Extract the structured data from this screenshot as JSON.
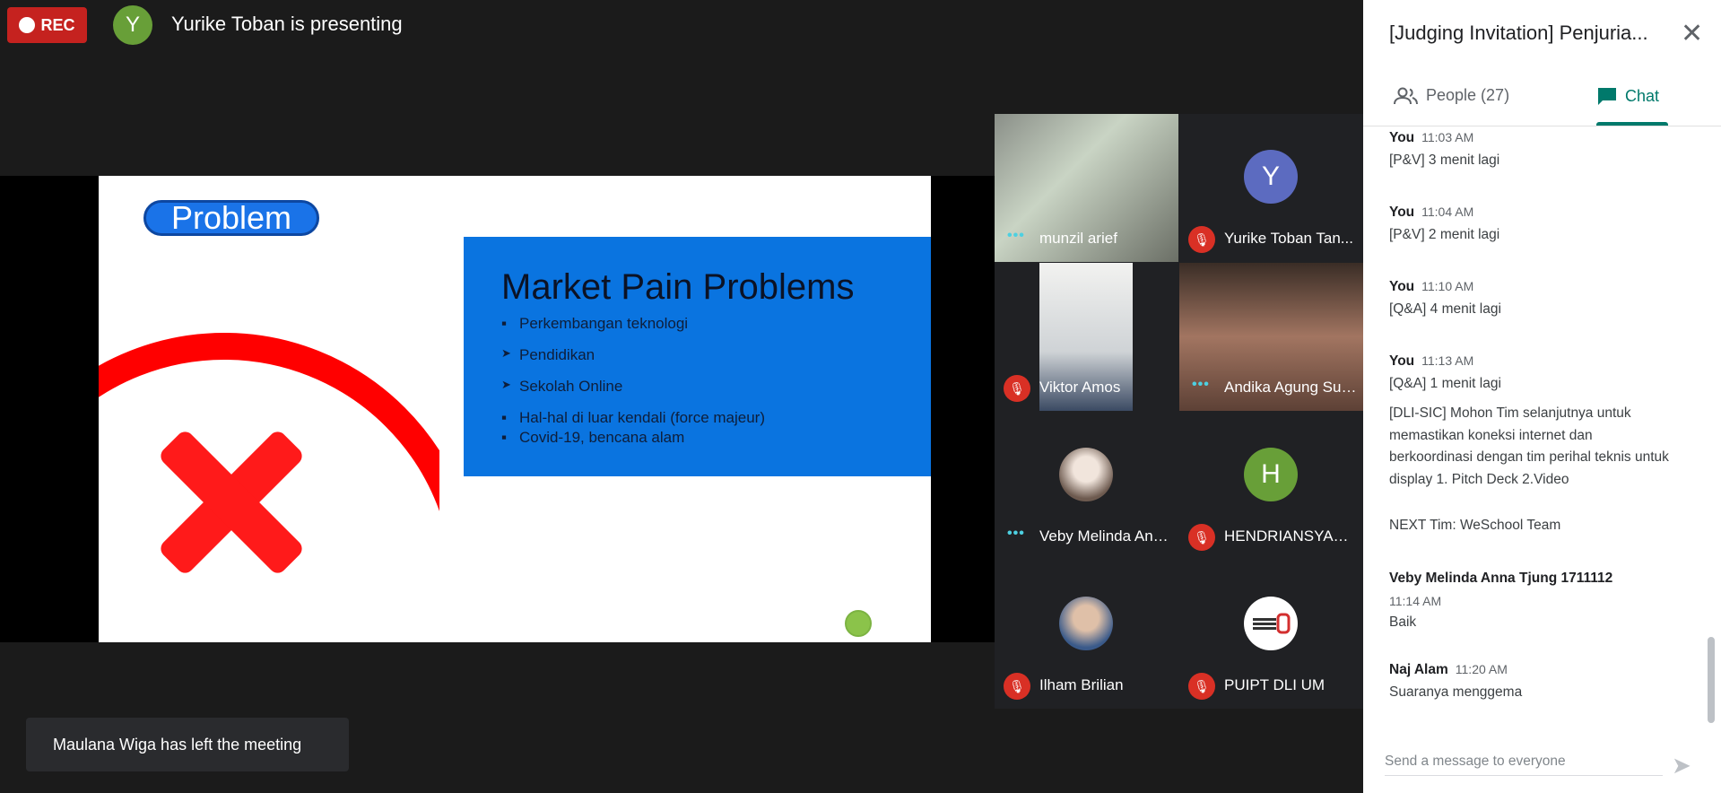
{
  "topbar": {
    "rec_label": "REC",
    "presenter_initial": "Y",
    "presenting_text": "Yurike Toban is presenting"
  },
  "slide": {
    "tag": "Problem",
    "heading": "Market Pain Problems",
    "bullets": [
      "Perkembangan teknologi",
      "Pendidikan",
      "Sekolah Online",
      "Hal-hal di luar kendali (force majeur)",
      "Covid-19, bencana alam"
    ]
  },
  "participants": [
    {
      "name": "munzil arief",
      "status": "talking"
    },
    {
      "name": "Yurike Toban Tan...",
      "status": "muted",
      "initial": "Y"
    },
    {
      "name": "Viktor Amos",
      "status": "muted"
    },
    {
      "name": "Andika Agung Sut...",
      "status": "talking"
    },
    {
      "name": "Veby Melinda Ann...",
      "status": "talking"
    },
    {
      "name": "HENDRIANSYAH ...",
      "status": "muted",
      "initial": "H"
    },
    {
      "name": "Ilham Brilian",
      "status": "muted"
    },
    {
      "name": "PUIPT DLI UM",
      "status": "muted"
    }
  ],
  "toast": "Maulana Wiga has left the meeting",
  "panel": {
    "title": "[Judging Invitation] Penjuria...",
    "tab_people": "People (27)",
    "tab_chat": "Chat",
    "messages": [
      {
        "sender": "You",
        "time": "11:03 AM",
        "text": "[P&V] 3 menit lagi"
      },
      {
        "sender": "You",
        "time": "11:04 AM",
        "text": "[P&V] 2 menit lagi"
      },
      {
        "sender": "You",
        "time": "11:10 AM",
        "text": "[Q&A] 4 menit lagi"
      },
      {
        "sender": "You",
        "time": "11:13 AM",
        "text": "[Q&A] 1 menit lagi"
      },
      {
        "text": "[DLI-SIC] Mohon Tim selanjutnya untuk memastikan koneksi internet dan berkoordinasi dengan tim perihal teknis untuk display 1. Pitch Deck 2.Video"
      },
      {
        "text": "NEXT Tim: WeSchool Team"
      },
      {
        "sender": "Veby Melinda Anna Tjung 1711112",
        "time": "11:14 AM",
        "text": "Baik"
      },
      {
        "sender": "Naj Alam",
        "time": "11:20 AM",
        "text": "Suaranya menggema"
      }
    ],
    "compose_placeholder": "Send a message to everyone"
  }
}
